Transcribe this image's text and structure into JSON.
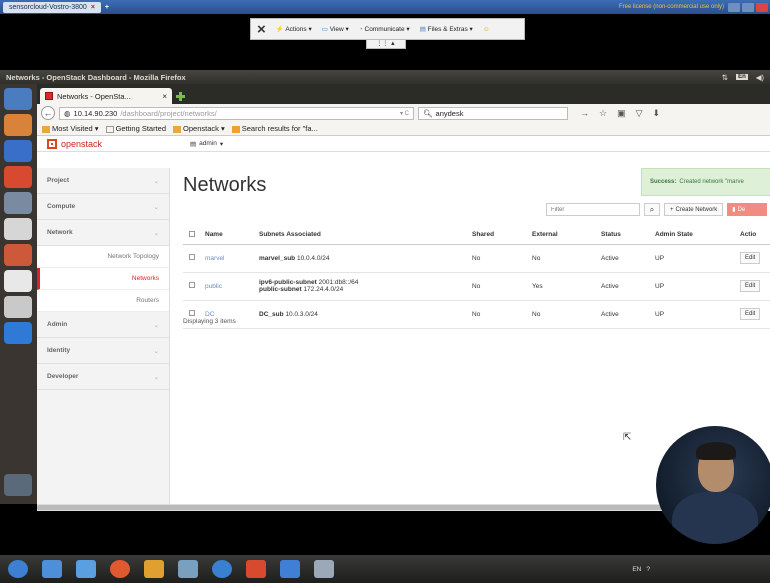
{
  "remote": {
    "tab_label": "sensorcloud-Vostro-3800",
    "license_text": "Free license (non-commercial use only)",
    "toolbar": {
      "actions": "Actions",
      "view": "View",
      "communicate": "Communicate",
      "files": "Files & Extras"
    }
  },
  "ubuntu": {
    "window_title": "Networks - OpenStack Dashboard - Mozilla Firefox",
    "kb_layout": "En"
  },
  "browser": {
    "tab_title": "Networks - OpenSta...",
    "url_host": "10.14.90.230",
    "url_path": "/dashboard/project/networks/",
    "search_value": "anydesk",
    "bookmarks": [
      "Most Visited",
      "Getting Started",
      "Openstack",
      "Search results for \"fa..."
    ]
  },
  "openstack": {
    "logo": "openstack",
    "project": "admin",
    "sidebar": {
      "project": "Project",
      "compute": "Compute",
      "network": "Network",
      "network_items": [
        "Network Topology",
        "Networks",
        "Routers"
      ],
      "admin": "Admin",
      "identity": "Identity",
      "developer": "Developer"
    },
    "page_title": "Networks",
    "alert": {
      "title": "Success:",
      "message": "Created network \"marve"
    },
    "filter_placeholder": "Filter",
    "create_label": "Create Network",
    "delete_label": "De",
    "columns": [
      "Name",
      "Subnets Associated",
      "Shared",
      "External",
      "Status",
      "Admin State",
      "Actio"
    ],
    "rows": [
      {
        "name": "marvel",
        "subnet1_name": "marvel_sub",
        "subnet1_cidr": "10.0.4.0/24",
        "subnet2_name": "",
        "subnet2_cidr": "",
        "shared": "No",
        "external": "No",
        "status": "Active",
        "admin_state": "UP",
        "action": "Edit"
      },
      {
        "name": "public",
        "subnet1_name": "ipv6-public-subnet",
        "subnet1_cidr": "2001:db8::/64",
        "subnet2_name": "public-subnet",
        "subnet2_cidr": "172.24.4.0/24",
        "shared": "No",
        "external": "Yes",
        "status": "Active",
        "admin_state": "UP",
        "action": "Edit"
      },
      {
        "name": "DC",
        "subnet1_name": "DC_sub",
        "subnet1_cidr": "10.0.3.0/24",
        "subnet2_name": "",
        "subnet2_cidr": "",
        "shared": "No",
        "external": "No",
        "status": "Active",
        "admin_state": "UP",
        "action": "Edit"
      }
    ],
    "displaying": "Displaying 3 items"
  },
  "tray": {
    "lang": "EN"
  }
}
